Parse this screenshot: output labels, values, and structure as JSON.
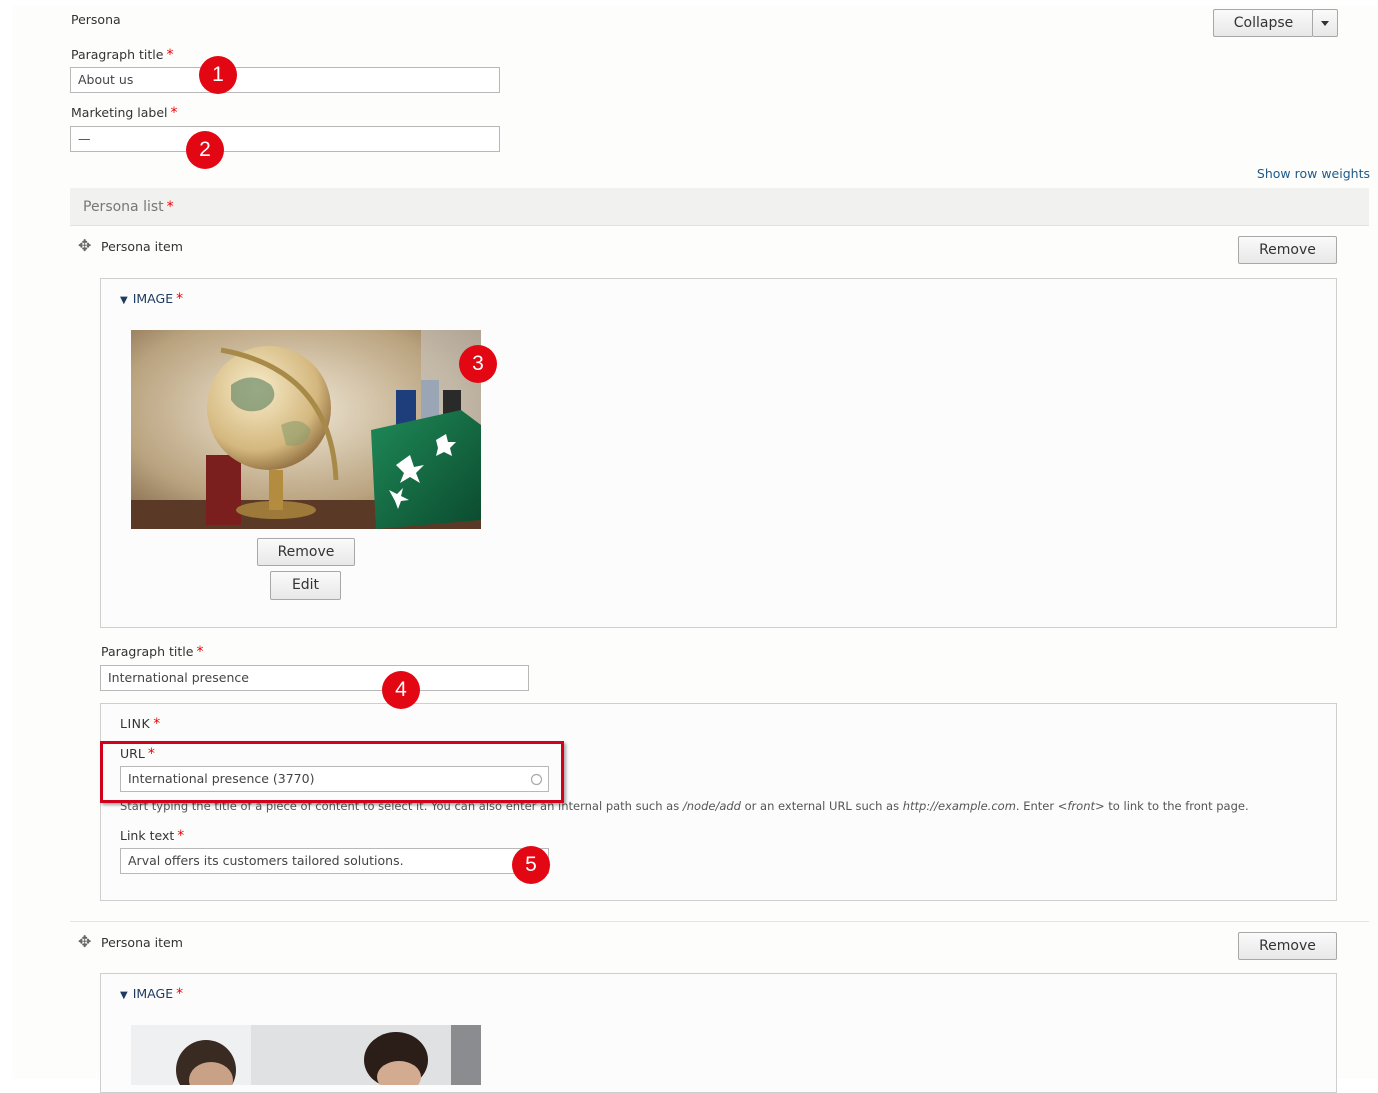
{
  "header": {
    "section_label": "Persona",
    "collapse_label": "Collapse",
    "paragraph_title_label": "Paragraph title",
    "paragraph_title_value": "About us",
    "marketing_label_label": "Marketing label",
    "marketing_label_value": "—",
    "required_mark": "*"
  },
  "show_row_weights": "Show row weights",
  "persona_list": {
    "label": "Persona list",
    "items": [
      {
        "item_label": "Persona item",
        "remove_label": "Remove",
        "image_section_label": "IMAGE",
        "image_remove_label": "Remove",
        "image_edit_label": "Edit",
        "paragraph_title_label": "Paragraph title",
        "paragraph_title_value": "International presence",
        "link_section_label": "LINK",
        "url_label": "URL",
        "url_value": "International presence  (3770)",
        "url_help": {
          "part1": "Start typing the title of a piece of content to select it. You can also enter an internal path such as ",
          "path_example": "/node/add",
          "part2": " or an external URL such as ",
          "url_example": "http://example.com",
          "part3": ". Enter ",
          "front_example": "<front>",
          "part4": " to link to the front page."
        },
        "link_text_label": "Link text",
        "link_text_value": "Arval offers its customers tailored solutions."
      },
      {
        "item_label": "Persona item",
        "remove_label": "Remove",
        "image_section_label": "IMAGE"
      }
    ]
  },
  "annotations": [
    "1",
    "2",
    "3",
    "4",
    "5"
  ],
  "icons": {
    "dropdown": "caret-down-icon",
    "drag": "drag-handle-icon",
    "collapse_triangle": "triangle-down-icon",
    "autocomplete": "autocomplete-circle-icon"
  },
  "colors": {
    "required": "#e00000",
    "annotation_badge": "#e30613",
    "highlight_box": "#d0021b",
    "link_blue": "#1e5a8a"
  }
}
